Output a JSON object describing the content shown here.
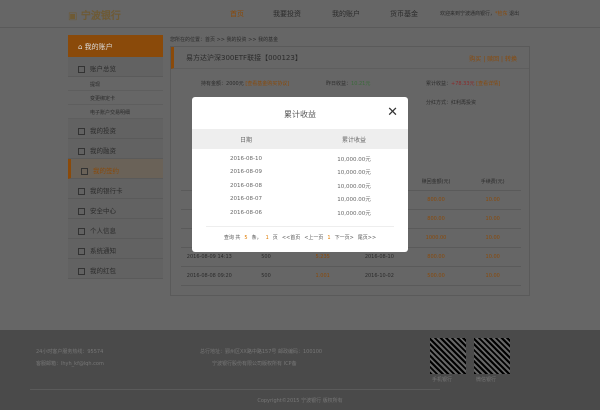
{
  "header": {
    "logo": "宁波银行",
    "nav": [
      "首页",
      "我要投资",
      "我的账户",
      "货币基金"
    ],
    "active_nav": 0,
    "welcome": "欢迎来到宁波通商银行，",
    "user": "*检东",
    "logout": "退出"
  },
  "sidebar": {
    "top": "我的账户",
    "overview": "账户总览",
    "subs": [
      "提现",
      "变更绑定卡",
      "电子账户交易明细"
    ],
    "items": [
      "我的投资",
      "我的融资",
      "我的签约",
      "我的银行卡",
      "安全中心",
      "个人信息",
      "系统通知",
      "我的红包"
    ],
    "active": "我的签约"
  },
  "breadcrumb": "您所在的位置：首页 >> 我的投资 >> 我的基金",
  "fund": {
    "name": "易方达沪深300ETF联接",
    "code": "【000123】",
    "actions": [
      "购买",
      "赎回",
      "转换"
    ],
    "hold_label": "持有金额：",
    "hold": "2000元",
    "hold_link": "[查看基金购买协议]",
    "yest_label": "昨日收益：",
    "yest": "10.21元",
    "total_label": "累计收益：",
    "total": "+78.33元",
    "total_link": "[查看详情]",
    "div": "分红方式：红利再投资"
  },
  "table": {
    "headers": [
      "赎回金额(元)",
      "手续费(元)"
    ],
    "rows": [
      [
        "",
        "",
        "",
        "",
        "800.00",
        "10.00"
      ],
      [
        "",
        "",
        "",
        "",
        "800.00",
        "10.00"
      ],
      [
        "",
        "",
        "",
        "",
        "1000.00",
        "10.00"
      ],
      [
        "2016-08-09 14:13",
        "500",
        "5.235",
        "2016-08-10",
        "800.00",
        "10.00"
      ],
      [
        "2016-08-08 09:20",
        "500",
        "1.001",
        "2016-10-02",
        "500.00",
        "10.00"
      ]
    ]
  },
  "footer": {
    "hotline": "24小时客户服务热线：95574",
    "email": "客服邮箱：lhyh_kf@lqh.com",
    "address": "总行地址：鄞州区XX路中路157号 邮政编码：100100",
    "company": "宁波银行股份有限公司版权所有 ICP备",
    "qr_labels": [
      "手机银行",
      "微信银行"
    ],
    "copyright": "Copyright©2015 宁波银行 版权所有"
  },
  "modal": {
    "title": "累计收益",
    "close": "✕",
    "headers": [
      "日期",
      "累计收益"
    ],
    "rows": [
      [
        "2016-08-10",
        "10,000.00元"
      ],
      [
        "2016-08-09",
        "10,000.00元"
      ],
      [
        "2016-08-08",
        "10,000.00元"
      ],
      [
        "2016-08-07",
        "10,000.00元"
      ],
      [
        "2016-08-06",
        "10,000.00元"
      ]
    ],
    "pager": {
      "prefix": "查询 共",
      "count": "5",
      "unit": "条，",
      "pages": "1",
      "page_unit": "页",
      "first": "<<首页",
      "prev": "<上一页",
      "current": "1",
      "next": "下一页>",
      "last": "尾页>>"
    }
  },
  "colors": {
    "accent": "#e07b00"
  }
}
